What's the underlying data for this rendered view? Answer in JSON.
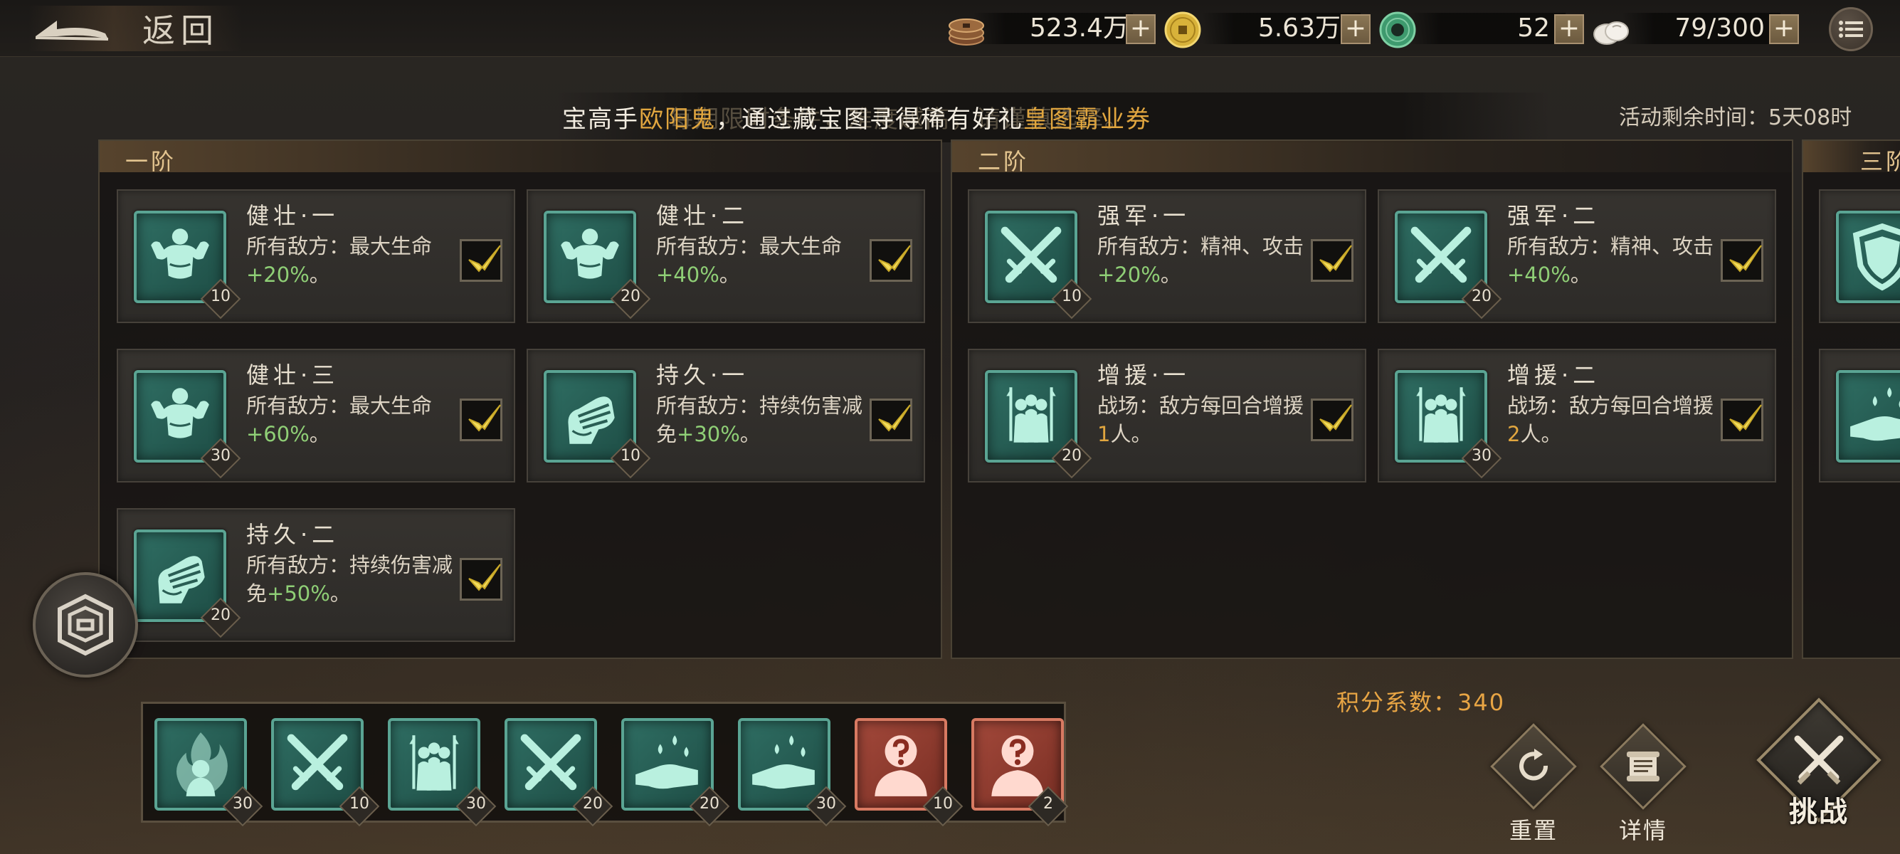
{
  "topbar": {
    "back_label": "返回",
    "resources": [
      {
        "icon": "copper-coins-icon",
        "value": "523.4万"
      },
      {
        "icon": "gold-coin-icon",
        "value": "5.63万"
      },
      {
        "icon": "jade-icon",
        "value": "52"
      },
      {
        "icon": "bun-icon",
        "value": "79/300"
      }
    ],
    "plus_label": "+"
  },
  "banner": {
    "text_1": "宝高手",
    "name_1": "欧阳鬼",
    "text_2": "，通过藏宝图寻得稀有好礼",
    "name_2": "皇图霸业",
    "name_2_suffix": "券",
    "ghost_text": "每期限时条件，难度越高，请谨慎选择。"
  },
  "event_time": "活动剩余时间：5天08时",
  "tiers": [
    {
      "title": "一阶",
      "cards": [
        {
          "name": "健壮·一",
          "desc_pre": "所有敌方：最大生命",
          "value": "+20%",
          "desc_post": "。",
          "level": "10",
          "icon": "strong-man-icon",
          "checked": true
        },
        {
          "name": "健壮·二",
          "desc_pre": "所有敌方：最大生命",
          "value": "+40%",
          "desc_post": "。",
          "level": "20",
          "icon": "strong-man-icon",
          "checked": true
        },
        {
          "name": "健壮·三",
          "desc_pre": "所有敌方：最大生命",
          "value": "+60%",
          "desc_post": "。",
          "level": "30",
          "icon": "strong-man-icon",
          "checked": true
        },
        {
          "name": "持久·一",
          "desc_pre": "所有敌方：持续伤害减免",
          "value": "+30%",
          "desc_post": "。",
          "level": "10",
          "icon": "armored-fist-icon",
          "checked": true
        },
        {
          "name": "持久·二",
          "desc_pre": "所有敌方：持续伤害减免",
          "value": "+50%",
          "desc_post": "。",
          "level": "20",
          "icon": "armored-fist-icon",
          "checked": true
        }
      ]
    },
    {
      "title": "二阶",
      "cards": [
        {
          "name": "强军·一",
          "desc_pre": "所有敌方：精神、攻击",
          "value": "+20%",
          "desc_post": "。",
          "level": "10",
          "icon": "crossed-swords-icon",
          "checked": true
        },
        {
          "name": "强军·二",
          "desc_pre": "所有敌方：精神、攻击",
          "value": "+40%",
          "desc_post": "。",
          "level": "20",
          "icon": "crossed-swords-icon",
          "checked": true
        },
        {
          "name": "增援·一",
          "desc_pre": "战场：敌方每回合增援",
          "value": "1",
          "desc_post": "人。",
          "level": "20",
          "icon": "army-icon",
          "checked": true
        },
        {
          "name": "增援·二",
          "desc_pre": "战场：敌方每回合增援",
          "value": "2",
          "desc_post": "人。",
          "level": "30",
          "icon": "army-icon",
          "checked": true
        }
      ]
    },
    {
      "title": "三阶",
      "cards": [
        {
          "icon": "shield-icon"
        },
        {
          "icon": "hand-icon"
        }
      ]
    }
  ],
  "selected_slots": [
    {
      "icon": "flame-general-icon",
      "level": "30",
      "color": "teal"
    },
    {
      "icon": "crossed-swords-icon",
      "level": "10",
      "color": "teal"
    },
    {
      "icon": "army-icon",
      "level": "30",
      "color": "teal"
    },
    {
      "icon": "crossed-swords-icon",
      "level": "20",
      "color": "teal"
    },
    {
      "icon": "hand-icon",
      "level": "20",
      "color": "teal"
    },
    {
      "icon": "hand-icon",
      "level": "30",
      "color": "teal"
    },
    {
      "icon": "mystery-person-icon",
      "level": "10",
      "color": "red"
    },
    {
      "icon": "mystery-person-icon",
      "level": "2",
      "color": "red"
    }
  ],
  "score": "积分系数：340",
  "actions": {
    "reset_label": "重置",
    "details_label": "详情",
    "challenge_label": "挑战"
  },
  "colors": {
    "accent_gold": "#e1a63f",
    "value_green": "#8fcf76",
    "icon_teal": "#2f6e63",
    "icon_red": "#a2483a"
  }
}
